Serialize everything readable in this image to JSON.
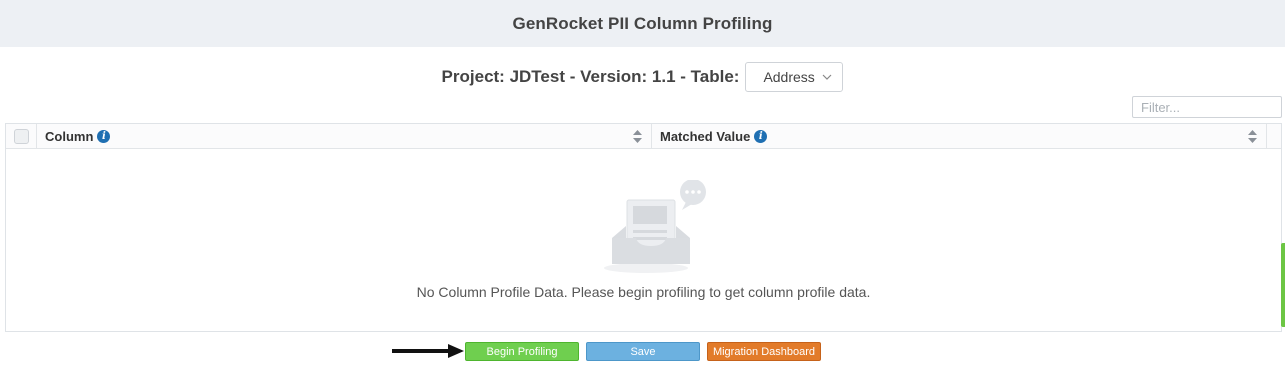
{
  "header": {
    "title": "GenRocket PII Column Profiling"
  },
  "project": {
    "label": "Project: JDTest - Version: 1.1 - Table:",
    "table_select": {
      "selected": "Address"
    }
  },
  "filter": {
    "placeholder": "Filter..."
  },
  "grid": {
    "columns": [
      {
        "label": "Column"
      },
      {
        "label": "Matched Value"
      }
    ],
    "rows": [],
    "empty_message": "No Column Profile Data. Please begin profiling to get column profile data."
  },
  "actions": {
    "begin_profiling": "Begin Profiling",
    "save": "Save",
    "migration_dashboard": "Migration Dashboard"
  },
  "colors": {
    "header_bg": "#edf0f4",
    "begin_btn": "#6fcf4f",
    "save_btn": "#6cb1e0",
    "migration_btn": "#e27b2a",
    "info_icon": "#1f6fb2"
  },
  "icons": {
    "info": "info-icon",
    "sort": "sort-icon",
    "select_chevron": "chevron-down-icon",
    "empty_state": "empty-inbox-icon",
    "pointer": "arrow-right-icon"
  }
}
